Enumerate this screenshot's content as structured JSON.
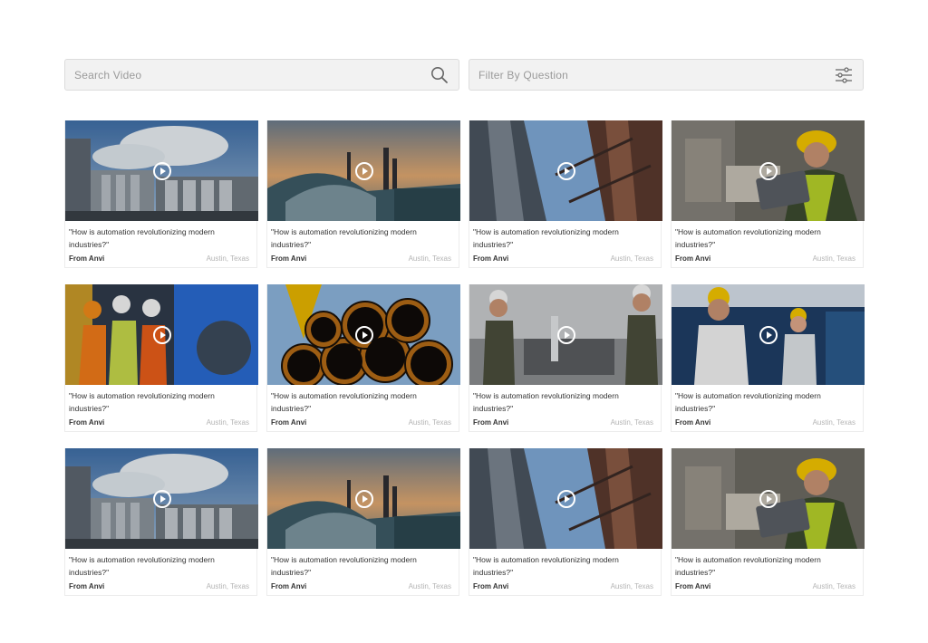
{
  "search": {
    "placeholder": "Search Video",
    "icon": "search-icon"
  },
  "filter": {
    "placeholder": "Filter By Question",
    "icon": "sliders-icon"
  },
  "play_icon": "play-icon",
  "cards": [
    {
      "scene": "silos",
      "question": "\"How is automation revolutionizing modern industries?\"",
      "from": "From Anvi",
      "location": "Austin, Texas"
    },
    {
      "scene": "power-plant",
      "question": "\"How is automation revolutionizing modern industries?\"",
      "from": "From Anvi",
      "location": "Austin, Texas"
    },
    {
      "scene": "skyscrapers",
      "question": "\"How is automation revolutionizing modern industries?\"",
      "from": "From Anvi",
      "location": "Austin, Texas"
    },
    {
      "scene": "worker-laptop",
      "question": "\"How is automation revolutionizing modern industries?\"",
      "from": "From Anvi",
      "location": "Austin, Texas"
    },
    {
      "scene": "engineers-tablet",
      "question": "\"How is automation revolutionizing modern industries?\"",
      "from": "From Anvi",
      "location": "Austin, Texas"
    },
    {
      "scene": "pipes",
      "question": "\"How is automation revolutionizing modern industries?\"",
      "from": "From Anvi",
      "location": "Austin, Texas"
    },
    {
      "scene": "factory-workers",
      "question": "\"How is automation revolutionizing modern industries?\"",
      "from": "From Anvi",
      "location": "Austin, Texas"
    },
    {
      "scene": "warehouse-team",
      "question": "\"How is automation revolutionizing modern industries?\"",
      "from": "From Anvi",
      "location": "Austin, Texas"
    },
    {
      "scene": "silos",
      "question": "\"How is automation revolutionizing modern industries?\"",
      "from": "From Anvi",
      "location": "Austin, Texas"
    },
    {
      "scene": "power-plant",
      "question": "\"How is automation revolutionizing modern industries?\"",
      "from": "From Anvi",
      "location": "Austin, Texas"
    },
    {
      "scene": "skyscrapers",
      "question": "\"How is automation revolutionizing modern industries?\"",
      "from": "From Anvi",
      "location": "Austin, Texas"
    },
    {
      "scene": "worker-laptop",
      "question": "\"How is automation revolutionizing modern industries?\"",
      "from": "From Anvi",
      "location": "Austin, Texas"
    }
  ]
}
